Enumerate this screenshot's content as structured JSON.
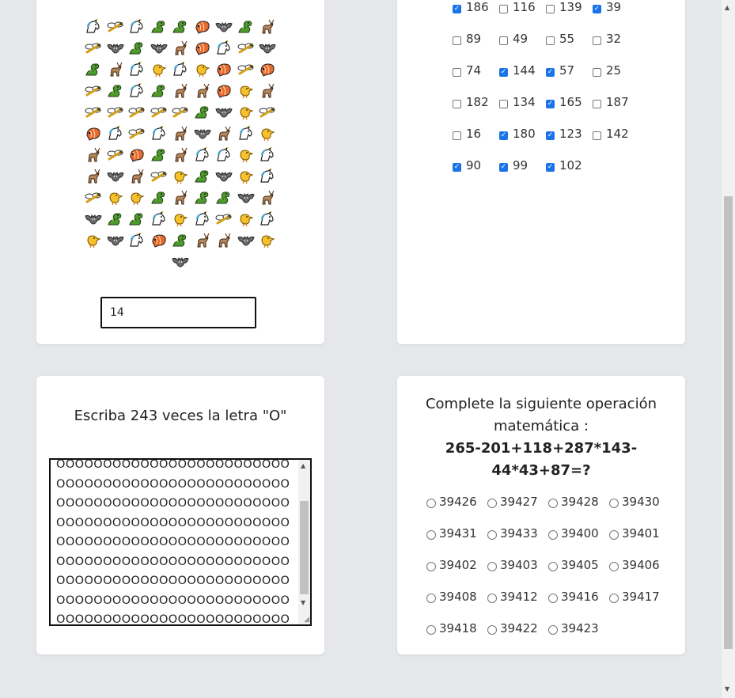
{
  "emoji_captcha": {
    "answer_value": "14",
    "emoji_rows": [
      [
        "unicorn",
        "dragonfly",
        "unicorn",
        "dragon",
        "dragon",
        "shrimp",
        "bat",
        "dragon",
        "deer"
      ],
      [
        "dragonfly",
        "bat",
        "dragon",
        "bat",
        "deer",
        "shrimp",
        "unicorn",
        "dragonfly",
        "bat"
      ],
      [
        "dragon",
        "deer",
        "unicorn",
        "chick",
        "unicorn",
        "chick",
        "shrimp",
        "dragonfly",
        "shrimp"
      ],
      [
        "dragonfly",
        "dragon",
        "unicorn",
        "dragon",
        "deer",
        "deer",
        "shrimp",
        "chick",
        "deer"
      ],
      [
        "dragonfly",
        "dragonfly",
        "dragonfly",
        "dragonfly",
        "dragonfly",
        "dragon",
        "bat",
        "chick",
        "dragonfly"
      ],
      [
        "shrimp",
        "unicorn",
        "dragonfly",
        "unicorn",
        "deer",
        "bat",
        "deer",
        "unicorn",
        "chick"
      ],
      [
        "deer",
        "dragonfly",
        "shrimp",
        "dragon",
        "deer",
        "unicorn",
        "unicorn",
        "chick",
        "unicorn"
      ],
      [
        "deer",
        "bat",
        "deer",
        "dragonfly",
        "chick",
        "dragon",
        "bat",
        "chick",
        "unicorn"
      ],
      [
        "dragonfly",
        "chick",
        "chick",
        "dragon",
        "deer",
        "dragon",
        "dragon",
        "bat",
        "deer"
      ],
      [
        "bat",
        "dragon",
        "dragon",
        "unicorn",
        "chick",
        "unicorn",
        "dragonfly",
        "chick",
        "unicorn"
      ],
      [
        "chick",
        "bat",
        "unicorn",
        "shrimp",
        "dragon",
        "deer",
        "deer",
        "bat",
        "chick"
      ],
      [
        "bat"
      ]
    ]
  },
  "number_checks": {
    "items": [
      {
        "label": "186",
        "checked": true
      },
      {
        "label": "116",
        "checked": false
      },
      {
        "label": "139",
        "checked": false
      },
      {
        "label": "39",
        "checked": true
      },
      {
        "label": "89",
        "checked": false
      },
      {
        "label": "49",
        "checked": false
      },
      {
        "label": "55",
        "checked": false
      },
      {
        "label": "32",
        "checked": false
      },
      {
        "label": "74",
        "checked": false
      },
      {
        "label": "144",
        "checked": true
      },
      {
        "label": "57",
        "checked": true
      },
      {
        "label": "25",
        "checked": false
      },
      {
        "label": "182",
        "checked": false
      },
      {
        "label": "134",
        "checked": false
      },
      {
        "label": "165",
        "checked": true
      },
      {
        "label": "187",
        "checked": false
      },
      {
        "label": "16",
        "checked": false
      },
      {
        "label": "180",
        "checked": true
      },
      {
        "label": "123",
        "checked": true
      },
      {
        "label": "142",
        "checked": false
      },
      {
        "label": "90",
        "checked": true
      },
      {
        "label": "99",
        "checked": true
      },
      {
        "label": "102",
        "checked": true
      }
    ]
  },
  "letter_task": {
    "title": "Escriba 243 veces la letra \"O\"",
    "text_value": "OOOOOOOOOOOOOOOOOOOOOOOOOOOOOOOOOOOOOOOOOOOOOOOOOOOOOOOOOOOOOOOOOOOOOOOOOOOOOOOOOOOOOOOOOOOOOOOOOOOOOOOOOOOOOOOOOOOOOOOOOOOOOOOOOOOOOOOOOOOOOOOOOOOOOOOOOOOOOOOOOOOOOOOOOOOOOOOOOOOOOOOOOOOOOOOOOOOOOOOOOOOOOOOOOOOOOOOOOOOOOOOOOOOOOO"
  },
  "math_task": {
    "title": "Complete la siguiente operación matemática :",
    "expression": "265-201+118+287*143-44*43+87=?",
    "options": [
      "39426",
      "39427",
      "39428",
      "39430",
      "39431",
      "39433",
      "39400",
      "39401",
      "39402",
      "39403",
      "39405",
      "39406",
      "39408",
      "39412",
      "39416",
      "39417",
      "39418",
      "39422",
      "39423"
    ]
  }
}
